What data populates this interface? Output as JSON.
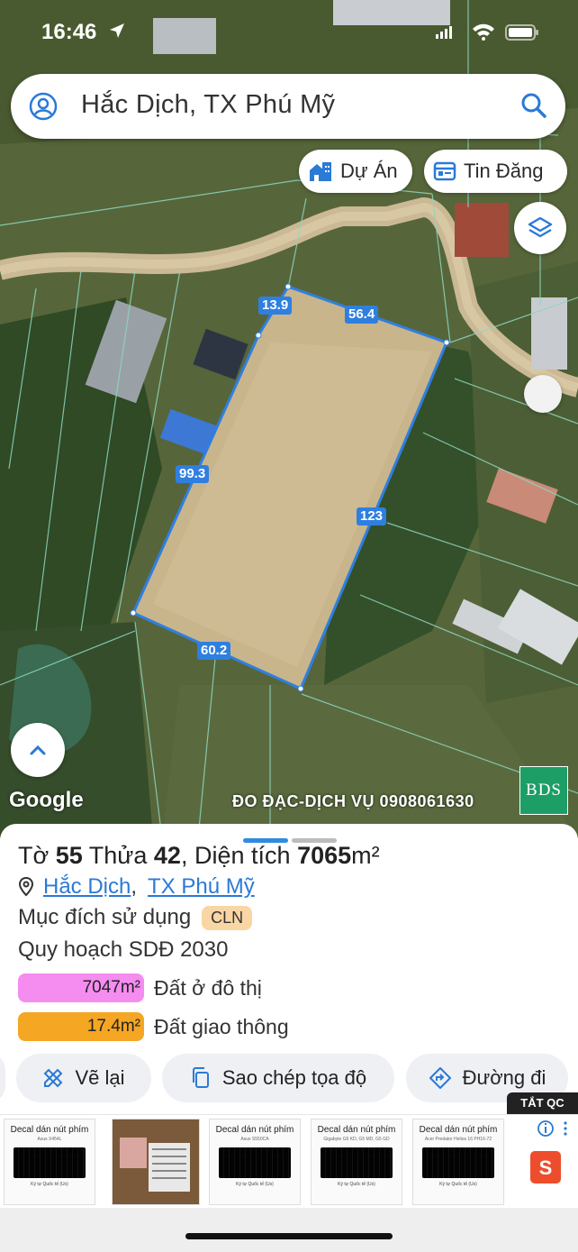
{
  "status_bar": {
    "time": "16:46"
  },
  "search": {
    "query": "Hắc Dịch, TX Phú Mỹ"
  },
  "chips": {
    "du_an": "Dự Án",
    "tin_dang": "Tin Đăng"
  },
  "map": {
    "google_label": "Google",
    "watermark": "ĐO ĐẠC-DỊCH VỤ 0908061630",
    "logo_text": "BDS",
    "edges": [
      "13.9",
      "56.4",
      "99.3",
      "123",
      "60.2"
    ],
    "boundary_color": "#2f7fe0"
  },
  "parcel": {
    "to_label": "Tờ",
    "to_value": "55",
    "thua_label": "Thửa",
    "thua_value": "42",
    "area_label": "Diện tích",
    "area_value": "7065",
    "area_unit": "m²",
    "location_ward": "Hắc Dịch",
    "location_town": "TX Phú Mỹ",
    "purpose_label": "Mục đích sử dụng",
    "purpose_code": "CLN",
    "plan_label": "Quy hoạch SDĐ 2030",
    "zones": [
      {
        "area": "7047m²",
        "label": "Đất ở đô thị",
        "color": "#f58cf0"
      },
      {
        "area": "17.4m²",
        "label": "Đất giao thông",
        "color": "#f5a623"
      }
    ]
  },
  "actions": {
    "redraw": "Vẽ lại",
    "copy_coords": "Sao chép tọa độ",
    "route": "Đường đi"
  },
  "ads": {
    "close_label": "TẮT QC",
    "items": [
      {
        "title": "Decal dán nút phím",
        "model": "Asus X454L",
        "foot": "Ký tự Quốc tế (Us)"
      },
      {
        "title": "",
        "model": "",
        "foot": ""
      },
      {
        "title": "Decal dán nút phím",
        "model": "Asus S550CA",
        "foot": "Ký tự Quốc tế (Us)"
      },
      {
        "title": "Decal dán nút phím",
        "model": "Gigabyte G5 KD, G5 MD, G5 GD",
        "foot": "Ký tự Quốc tế (Us)"
      },
      {
        "title": "Decal dán nút phím",
        "model": "Acer Predator Helios 16 PH16-72",
        "foot": "Ký tự Quốc tế (Us)"
      }
    ]
  }
}
